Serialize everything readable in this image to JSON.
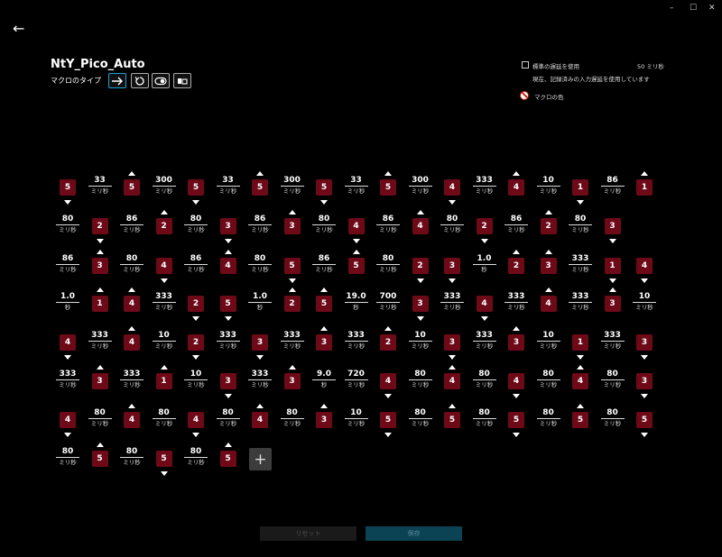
{
  "window": {
    "minimize": "–",
    "maximize": "☐",
    "close": "✕"
  },
  "back_icon": "←",
  "title": "NtY_Pico_Auto",
  "macro_type_label": "マクロのタイプ",
  "macro_types": [
    {
      "icon": "arrow-right-icon",
      "active": true
    },
    {
      "icon": "repeat-icon",
      "active": false
    },
    {
      "icon": "toggle-icon",
      "active": false
    },
    {
      "icon": "sequence-icon",
      "active": false
    }
  ],
  "settings": {
    "standard_delay_label": "標準の遅延を使用",
    "standard_delay_value": "50 ミリ秒",
    "recorded_delay_note": "現在、記録済みの入力遅延を使用しています",
    "macro_color_label": "マクロの色"
  },
  "colors": {
    "key": "#6e0a18",
    "accent": "#1da1d8",
    "save_bg": "#0b4355"
  },
  "sequence_rows": [
    [
      {
        "t": "k",
        "v": "5",
        "d": "down"
      },
      {
        "t": "d",
        "v": "33",
        "u": "ミリ秒"
      },
      {
        "t": "k",
        "v": "5",
        "d": "up"
      },
      {
        "t": "d",
        "v": "300",
        "u": "ミリ秒"
      },
      {
        "t": "k",
        "v": "5",
        "d": "down"
      },
      {
        "t": "d",
        "v": "33",
        "u": "ミリ秒"
      },
      {
        "t": "k",
        "v": "5",
        "d": "up"
      },
      {
        "t": "d",
        "v": "300",
        "u": "ミリ秒"
      },
      {
        "t": "k",
        "v": "5",
        "d": "down"
      },
      {
        "t": "d",
        "v": "33",
        "u": "ミリ秒"
      },
      {
        "t": "k",
        "v": "5",
        "d": "up"
      },
      {
        "t": "d",
        "v": "300",
        "u": "ミリ秒"
      },
      {
        "t": "k",
        "v": "4",
        "d": "down"
      },
      {
        "t": "d",
        "v": "333",
        "u": "ミリ秒"
      },
      {
        "t": "k",
        "v": "4",
        "d": "up"
      },
      {
        "t": "d",
        "v": "10",
        "u": "ミリ秒"
      },
      {
        "t": "k",
        "v": "1",
        "d": "down"
      },
      {
        "t": "d",
        "v": "86",
        "u": "ミリ秒"
      },
      {
        "t": "k",
        "v": "1",
        "d": "up"
      }
    ],
    [
      {
        "t": "d",
        "v": "80",
        "u": "ミリ秒"
      },
      {
        "t": "k",
        "v": "2",
        "d": "down"
      },
      {
        "t": "d",
        "v": "86",
        "u": "ミリ秒"
      },
      {
        "t": "k",
        "v": "2",
        "d": "up"
      },
      {
        "t": "d",
        "v": "80",
        "u": "ミリ秒"
      },
      {
        "t": "k",
        "v": "3",
        "d": "down"
      },
      {
        "t": "d",
        "v": "86",
        "u": "ミリ秒"
      },
      {
        "t": "k",
        "v": "3",
        "d": "up"
      },
      {
        "t": "d",
        "v": "80",
        "u": "ミリ秒"
      },
      {
        "t": "k",
        "v": "4",
        "d": "down"
      },
      {
        "t": "d",
        "v": "86",
        "u": "ミリ秒"
      },
      {
        "t": "k",
        "v": "4",
        "d": "up"
      },
      {
        "t": "d",
        "v": "80",
        "u": "ミリ秒"
      },
      {
        "t": "k",
        "v": "2",
        "d": "down"
      },
      {
        "t": "d",
        "v": "86",
        "u": "ミリ秒"
      },
      {
        "t": "k",
        "v": "2",
        "d": "up"
      },
      {
        "t": "d",
        "v": "80",
        "u": "ミリ秒"
      },
      {
        "t": "k",
        "v": "3",
        "d": "down"
      }
    ],
    [
      {
        "t": "d",
        "v": "86",
        "u": "ミリ秒"
      },
      {
        "t": "k",
        "v": "3",
        "d": "up"
      },
      {
        "t": "d",
        "v": "80",
        "u": "ミリ秒"
      },
      {
        "t": "k",
        "v": "4",
        "d": "down"
      },
      {
        "t": "d",
        "v": "86",
        "u": "ミリ秒"
      },
      {
        "t": "k",
        "v": "4",
        "d": "up"
      },
      {
        "t": "d",
        "v": "80",
        "u": "ミリ秒"
      },
      {
        "t": "k",
        "v": "5",
        "d": "down"
      },
      {
        "t": "d",
        "v": "86",
        "u": "ミリ秒"
      },
      {
        "t": "k",
        "v": "5",
        "d": "up"
      },
      {
        "t": "d",
        "v": "80",
        "u": "ミリ秒"
      },
      {
        "t": "k",
        "v": "2",
        "d": "down"
      },
      {
        "t": "k",
        "v": "3",
        "d": "down"
      },
      {
        "t": "d",
        "v": "1.0",
        "u": "秒"
      },
      {
        "t": "k",
        "v": "2",
        "d": "up"
      },
      {
        "t": "k",
        "v": "3",
        "d": "up"
      },
      {
        "t": "d",
        "v": "333",
        "u": "ミリ秒"
      },
      {
        "t": "k",
        "v": "1",
        "d": "down"
      },
      {
        "t": "k",
        "v": "4",
        "d": "down"
      }
    ],
    [
      {
        "t": "d",
        "v": "1.0",
        "u": "秒"
      },
      {
        "t": "k",
        "v": "1",
        "d": "up"
      },
      {
        "t": "k",
        "v": "4",
        "d": "up"
      },
      {
        "t": "d",
        "v": "333",
        "u": "ミリ秒"
      },
      {
        "t": "k",
        "v": "2",
        "d": "down"
      },
      {
        "t": "k",
        "v": "5",
        "d": "down"
      },
      {
        "t": "d",
        "v": "1.0",
        "u": "秒"
      },
      {
        "t": "k",
        "v": "2",
        "d": "up"
      },
      {
        "t": "k",
        "v": "5",
        "d": "up"
      },
      {
        "t": "d",
        "v": "19.0",
        "u": "秒"
      },
      {
        "t": "d",
        "v": "700",
        "u": "ミリ秒"
      },
      {
        "t": "k",
        "v": "3",
        "d": "down"
      },
      {
        "t": "d",
        "v": "333",
        "u": "ミリ秒"
      },
      {
        "t": "k",
        "v": "4",
        "d": "down"
      },
      {
        "t": "d",
        "v": "333",
        "u": "ミリ秒"
      },
      {
        "t": "k",
        "v": "4",
        "d": "up"
      },
      {
        "t": "d",
        "v": "333",
        "u": "ミリ秒"
      },
      {
        "t": "k",
        "v": "3",
        "d": "up"
      },
      {
        "t": "d",
        "v": "10",
        "u": "ミリ秒"
      }
    ],
    [
      {
        "t": "k",
        "v": "4",
        "d": "down"
      },
      {
        "t": "d",
        "v": "333",
        "u": "ミリ秒"
      },
      {
        "t": "k",
        "v": "4",
        "d": "up"
      },
      {
        "t": "d",
        "v": "10",
        "u": "ミリ秒"
      },
      {
        "t": "k",
        "v": "2",
        "d": "down"
      },
      {
        "t": "d",
        "v": "333",
        "u": "ミリ秒"
      },
      {
        "t": "k",
        "v": "3",
        "d": "down"
      },
      {
        "t": "d",
        "v": "333",
        "u": "ミリ秒"
      },
      {
        "t": "k",
        "v": "3",
        "d": "up"
      },
      {
        "t": "d",
        "v": "333",
        "u": "ミリ秒"
      },
      {
        "t": "k",
        "v": "2",
        "d": "up"
      },
      {
        "t": "d",
        "v": "10",
        "u": "ミリ秒"
      },
      {
        "t": "k",
        "v": "3",
        "d": "down"
      },
      {
        "t": "d",
        "v": "333",
        "u": "ミリ秒"
      },
      {
        "t": "k",
        "v": "3",
        "d": "up"
      },
      {
        "t": "d",
        "v": "10",
        "u": "ミリ秒"
      },
      {
        "t": "k",
        "v": "1",
        "d": "down"
      },
      {
        "t": "d",
        "v": "333",
        "u": "ミリ秒"
      },
      {
        "t": "k",
        "v": "3",
        "d": "down"
      }
    ],
    [
      {
        "t": "d",
        "v": "333",
        "u": "ミリ秒"
      },
      {
        "t": "k",
        "v": "3",
        "d": "up"
      },
      {
        "t": "d",
        "v": "333",
        "u": "ミリ秒"
      },
      {
        "t": "k",
        "v": "1",
        "d": "up"
      },
      {
        "t": "d",
        "v": "10",
        "u": "ミリ秒"
      },
      {
        "t": "k",
        "v": "3",
        "d": "down"
      },
      {
        "t": "d",
        "v": "333",
        "u": "ミリ秒"
      },
      {
        "t": "k",
        "v": "3",
        "d": "up"
      },
      {
        "t": "d",
        "v": "9.0",
        "u": "秒"
      },
      {
        "t": "d",
        "v": "720",
        "u": "ミリ秒"
      },
      {
        "t": "k",
        "v": "4",
        "d": "down"
      },
      {
        "t": "d",
        "v": "80",
        "u": "ミリ秒"
      },
      {
        "t": "k",
        "v": "4",
        "d": "up"
      },
      {
        "t": "d",
        "v": "80",
        "u": "ミリ秒"
      },
      {
        "t": "k",
        "v": "4",
        "d": "down"
      },
      {
        "t": "d",
        "v": "80",
        "u": "ミリ秒"
      },
      {
        "t": "k",
        "v": "4",
        "d": "up"
      },
      {
        "t": "d",
        "v": "80",
        "u": "ミリ秒"
      },
      {
        "t": "k",
        "v": "3",
        "d": "down"
      }
    ],
    [
      {
        "t": "k",
        "v": "4",
        "d": "down"
      },
      {
        "t": "d",
        "v": "80",
        "u": "ミリ秒"
      },
      {
        "t": "k",
        "v": "4",
        "d": "up"
      },
      {
        "t": "d",
        "v": "80",
        "u": "ミリ秒"
      },
      {
        "t": "k",
        "v": "4",
        "d": "down"
      },
      {
        "t": "d",
        "v": "80",
        "u": "ミリ秒"
      },
      {
        "t": "k",
        "v": "4",
        "d": "up"
      },
      {
        "t": "d",
        "v": "80",
        "u": "ミリ秒"
      },
      {
        "t": "k",
        "v": "3",
        "d": "up"
      },
      {
        "t": "d",
        "v": "10",
        "u": "ミリ秒"
      },
      {
        "t": "k",
        "v": "5",
        "d": "down"
      },
      {
        "t": "d",
        "v": "80",
        "u": "ミリ秒"
      },
      {
        "t": "k",
        "v": "5",
        "d": "up"
      },
      {
        "t": "d",
        "v": "80",
        "u": "ミリ秒"
      },
      {
        "t": "k",
        "v": "5",
        "d": "down"
      },
      {
        "t": "d",
        "v": "80",
        "u": "ミリ秒"
      },
      {
        "t": "k",
        "v": "5",
        "d": "up"
      },
      {
        "t": "d",
        "v": "80",
        "u": "ミリ秒"
      },
      {
        "t": "k",
        "v": "5",
        "d": "down"
      }
    ],
    [
      {
        "t": "d",
        "v": "80",
        "u": "ミリ秒"
      },
      {
        "t": "k",
        "v": "5",
        "d": "up"
      },
      {
        "t": "d",
        "v": "80",
        "u": "ミリ秒"
      },
      {
        "t": "k",
        "v": "5",
        "d": "down"
      },
      {
        "t": "d",
        "v": "80",
        "u": "ミリ秒"
      },
      {
        "t": "k",
        "v": "5",
        "d": "up"
      }
    ]
  ],
  "add_button": "+",
  "reset_label": "リセット",
  "save_label": "保存"
}
